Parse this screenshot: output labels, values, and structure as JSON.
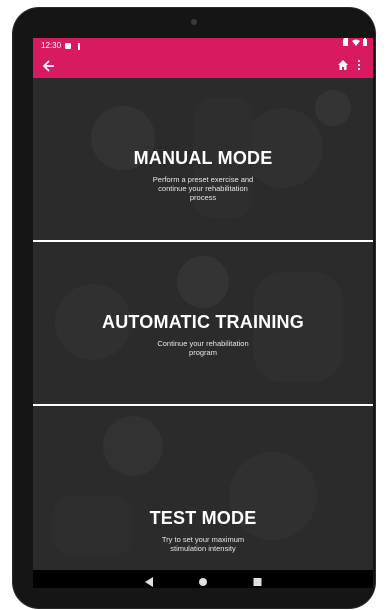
{
  "status": {
    "time": "12:30"
  },
  "toolbar": {
    "back_icon": "arrow-left-icon",
    "home_icon": "home-icon",
    "menu_icon": "more-vertical-icon"
  },
  "cards": [
    {
      "title": "MANUAL MODE",
      "description_lines": [
        "Perform a preset exercise and",
        "continue your rehabilitation",
        "process"
      ]
    },
    {
      "title": "AUTOMATIC TRAINING",
      "description_lines": [
        "Continue your rehabilitation",
        "program"
      ]
    },
    {
      "title": "TEST MODE",
      "description_lines": [
        "Try to set your maximum",
        "stimulation intensity"
      ]
    }
  ],
  "system_nav": {
    "back_icon": "triangle-back-icon",
    "home_icon": "circle-home-icon",
    "recents_icon": "square-recents-icon"
  },
  "colors": {
    "accent": "#d81b60",
    "card_overlay": "#343434",
    "text": "#ffffff"
  }
}
